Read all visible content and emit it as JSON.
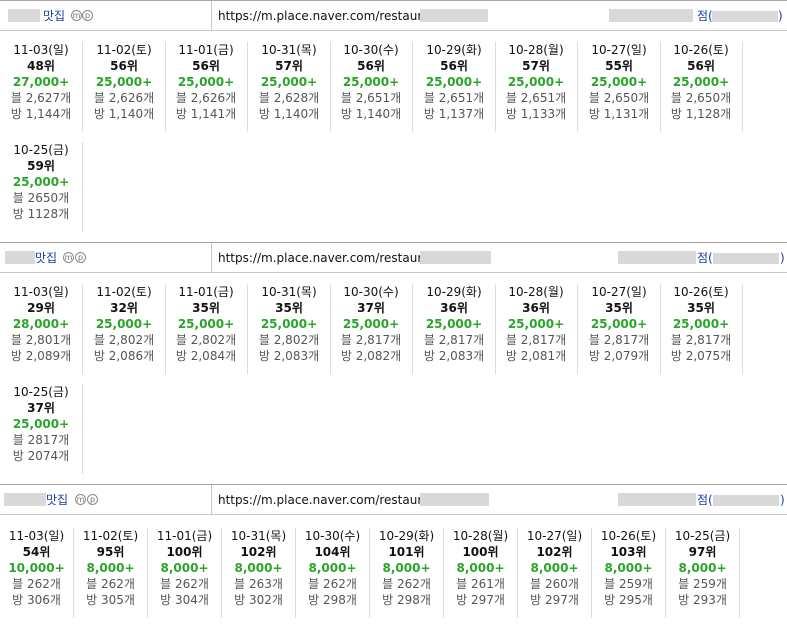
{
  "url_prefix": "https://m.place.naver.com/restaurant/",
  "tag_m": "ⓜ",
  "tag_p": "ⓟ",
  "branch_suffix": "점(",
  "paren_close": ")",
  "blocks": [
    {
      "name_suffix": "맛집",
      "stats": [
        {
          "date": "11-03(일)",
          "rank": "48위",
          "count": "27,000+",
          "blog": "블 2,627개",
          "visit": "방 1,144개"
        },
        {
          "date": "11-02(토)",
          "rank": "56위",
          "count": "25,000+",
          "blog": "블 2,626개",
          "visit": "방 1,140개"
        },
        {
          "date": "11-01(금)",
          "rank": "56위",
          "count": "25,000+",
          "blog": "블 2,626개",
          "visit": "방 1,141개"
        },
        {
          "date": "10-31(목)",
          "rank": "57위",
          "count": "25,000+",
          "blog": "블 2,628개",
          "visit": "방 1,140개"
        },
        {
          "date": "10-30(수)",
          "rank": "56위",
          "count": "25,000+",
          "blog": "블 2,651개",
          "visit": "방 1,140개"
        },
        {
          "date": "10-29(화)",
          "rank": "56위",
          "count": "25,000+",
          "blog": "블 2,651개",
          "visit": "방 1,137개"
        },
        {
          "date": "10-28(월)",
          "rank": "57위",
          "count": "25,000+",
          "blog": "블 2,651개",
          "visit": "방 1,133개"
        },
        {
          "date": "10-27(일)",
          "rank": "55위",
          "count": "25,000+",
          "blog": "블 2,650개",
          "visit": "방 1,131개"
        },
        {
          "date": "10-26(토)",
          "rank": "56위",
          "count": "25,000+",
          "blog": "블 2,650개",
          "visit": "방 1,128개"
        },
        {
          "date": "10-25(금)",
          "rank": "59위",
          "count": "25,000+",
          "blog": "블 2650개",
          "visit": "방 1128개"
        }
      ]
    },
    {
      "name_suffix": "맛집",
      "stats": [
        {
          "date": "11-03(일)",
          "rank": "29위",
          "count": "28,000+",
          "blog": "블 2,801개",
          "visit": "방 2,089개"
        },
        {
          "date": "11-02(토)",
          "rank": "32위",
          "count": "25,000+",
          "blog": "블 2,802개",
          "visit": "방 2,086개"
        },
        {
          "date": "11-01(금)",
          "rank": "35위",
          "count": "25,000+",
          "blog": "블 2,802개",
          "visit": "방 2,084개"
        },
        {
          "date": "10-31(목)",
          "rank": "35위",
          "count": "25,000+",
          "blog": "블 2,802개",
          "visit": "방 2,083개"
        },
        {
          "date": "10-30(수)",
          "rank": "37위",
          "count": "25,000+",
          "blog": "블 2,817개",
          "visit": "방 2,082개"
        },
        {
          "date": "10-29(화)",
          "rank": "36위",
          "count": "25,000+",
          "blog": "블 2,817개",
          "visit": "방 2,083개"
        },
        {
          "date": "10-28(월)",
          "rank": "36위",
          "count": "25,000+",
          "blog": "블 2,817개",
          "visit": "방 2,081개"
        },
        {
          "date": "10-27(일)",
          "rank": "35위",
          "count": "25,000+",
          "blog": "블 2,817개",
          "visit": "방 2,079개"
        },
        {
          "date": "10-26(토)",
          "rank": "35위",
          "count": "25,000+",
          "blog": "블 2,817개",
          "visit": "방 2,075개"
        },
        {
          "date": "10-25(금)",
          "rank": "37위",
          "count": "25,000+",
          "blog": "블 2817개",
          "visit": "방 2074개"
        }
      ]
    },
    {
      "name_suffix": "맛집",
      "stats": [
        {
          "date": "11-03(일)",
          "rank": "54위",
          "count": "10,000+",
          "blog": "블 262개",
          "visit": "방 306개"
        },
        {
          "date": "11-02(토)",
          "rank": "95위",
          "count": "8,000+",
          "blog": "블 262개",
          "visit": "방 305개"
        },
        {
          "date": "11-01(금)",
          "rank": "100위",
          "count": "8,000+",
          "blog": "블 262개",
          "visit": "방 304개"
        },
        {
          "date": "10-31(목)",
          "rank": "102위",
          "count": "8,000+",
          "blog": "블 263개",
          "visit": "방 302개"
        },
        {
          "date": "10-30(수)",
          "rank": "104위",
          "count": "8,000+",
          "blog": "블 262개",
          "visit": "방 298개"
        },
        {
          "date": "10-29(화)",
          "rank": "101위",
          "count": "8,000+",
          "blog": "블 262개",
          "visit": "방 298개"
        },
        {
          "date": "10-28(월)",
          "rank": "100위",
          "count": "8,000+",
          "blog": "블 261개",
          "visit": "방 297개"
        },
        {
          "date": "10-27(일)",
          "rank": "102위",
          "count": "8,000+",
          "blog": "블 260개",
          "visit": "방 297개"
        },
        {
          "date": "10-26(토)",
          "rank": "103위",
          "count": "8,000+",
          "blog": "블 259개",
          "visit": "방 295개"
        },
        {
          "date": "10-25(금)",
          "rank": "97위",
          "count": "8,000+",
          "blog": "블 259개",
          "visit": "방 293개"
        }
      ]
    }
  ],
  "colors": {
    "count_green": "#2aa52a",
    "link_blue": "#1a3ba8",
    "mask_gray": "#d9d9d9"
  }
}
